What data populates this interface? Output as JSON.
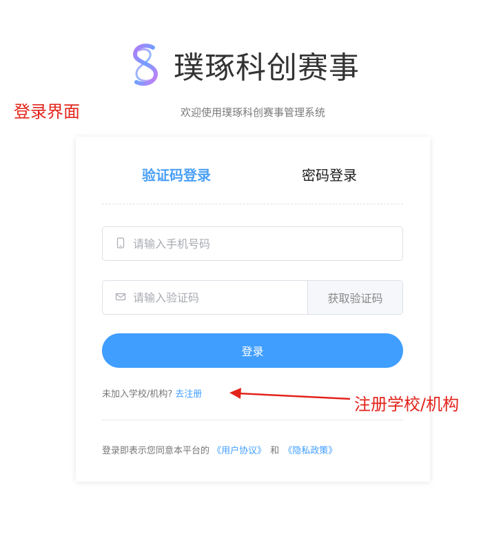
{
  "brand": {
    "name": "璞琢科创赛事",
    "logo_icon": "intertwined-s-logo-icon"
  },
  "annotations": {
    "page_label": "登录界面",
    "register_label": "注册学校/机构",
    "arrow_icon": "red-arrow-icon",
    "color": "#e2231a"
  },
  "subtitle": "欢迎使用璞琢科创赛事管理系统",
  "tabs": [
    {
      "label": "验证码登录",
      "active": true
    },
    {
      "label": "密码登录",
      "active": false
    }
  ],
  "phone_field": {
    "placeholder": "请输入手机号码",
    "value": "",
    "icon": "mobile-phone-icon"
  },
  "code_field": {
    "placeholder": "请输入验证码",
    "value": "",
    "icon": "envelope-icon"
  },
  "get_code_label": "获取验证码",
  "login_label": "登录",
  "register": {
    "prompt": "未加入学校/机构?",
    "link": "去注册"
  },
  "agreement": {
    "prefix": "登录即表示您同意本平台的",
    "user_agreement": "《用户协议》",
    "and": "和",
    "privacy_policy": "《隐私政策》"
  },
  "colors": {
    "accent": "#409eff",
    "active_tab": "#4a9ff5",
    "annotation": "#e2231a"
  }
}
